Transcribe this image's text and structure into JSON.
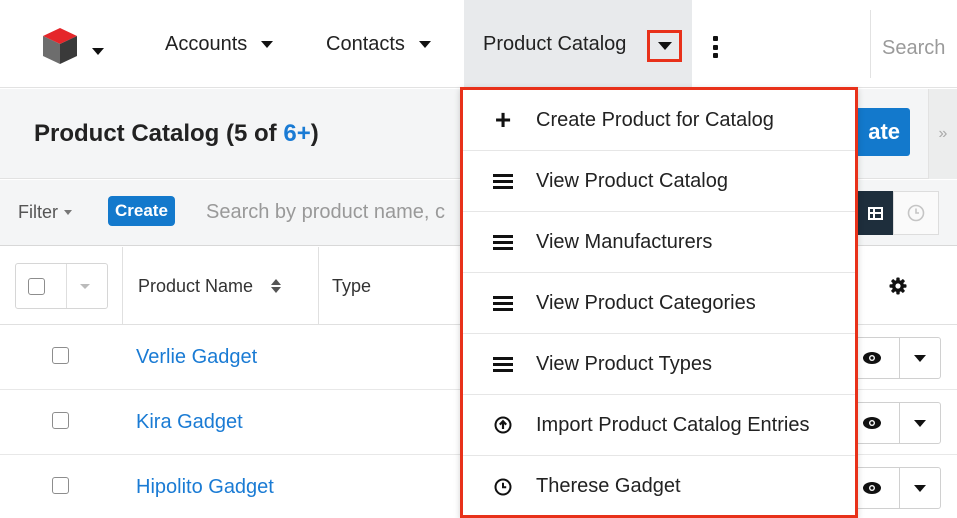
{
  "nav": {
    "accounts_label": "Accounts",
    "contacts_label": "Contacts",
    "catalog_label": "Product Catalog",
    "search_placeholder": "Search"
  },
  "list_header": {
    "title": "Product Catalog",
    "count_text": "(5 of ",
    "more_text": "6+",
    "close_paren": ")",
    "create_label": "ate"
  },
  "filter_bar": {
    "filter_label": "Filter",
    "create_label": "Create",
    "search_placeholder": "Search by product name, c"
  },
  "table": {
    "columns": [
      "Product Name",
      "Type"
    ],
    "rows": [
      {
        "name": "Verlie Gadget"
      },
      {
        "name": "Kira Gadget"
      },
      {
        "name": "Hipolito Gadget"
      }
    ]
  },
  "dropdown": {
    "items": [
      {
        "label": "Create Product for Catalog",
        "icon": "plus-icon"
      },
      {
        "label": "View Product Catalog",
        "icon": "list-icon"
      },
      {
        "label": "View Manufacturers",
        "icon": "list-icon"
      },
      {
        "label": "View Product Categories",
        "icon": "list-icon"
      },
      {
        "label": "View Product Types",
        "icon": "list-icon"
      },
      {
        "label": "Import Product Catalog Entries",
        "icon": "upload-icon"
      },
      {
        "label": "Therese Gadget",
        "icon": "clock-icon"
      }
    ]
  },
  "colors": {
    "accent": "#1379cc",
    "link": "#1a7bd4",
    "highlight": "#e8311a",
    "logo_red": "#cc1f1f"
  }
}
